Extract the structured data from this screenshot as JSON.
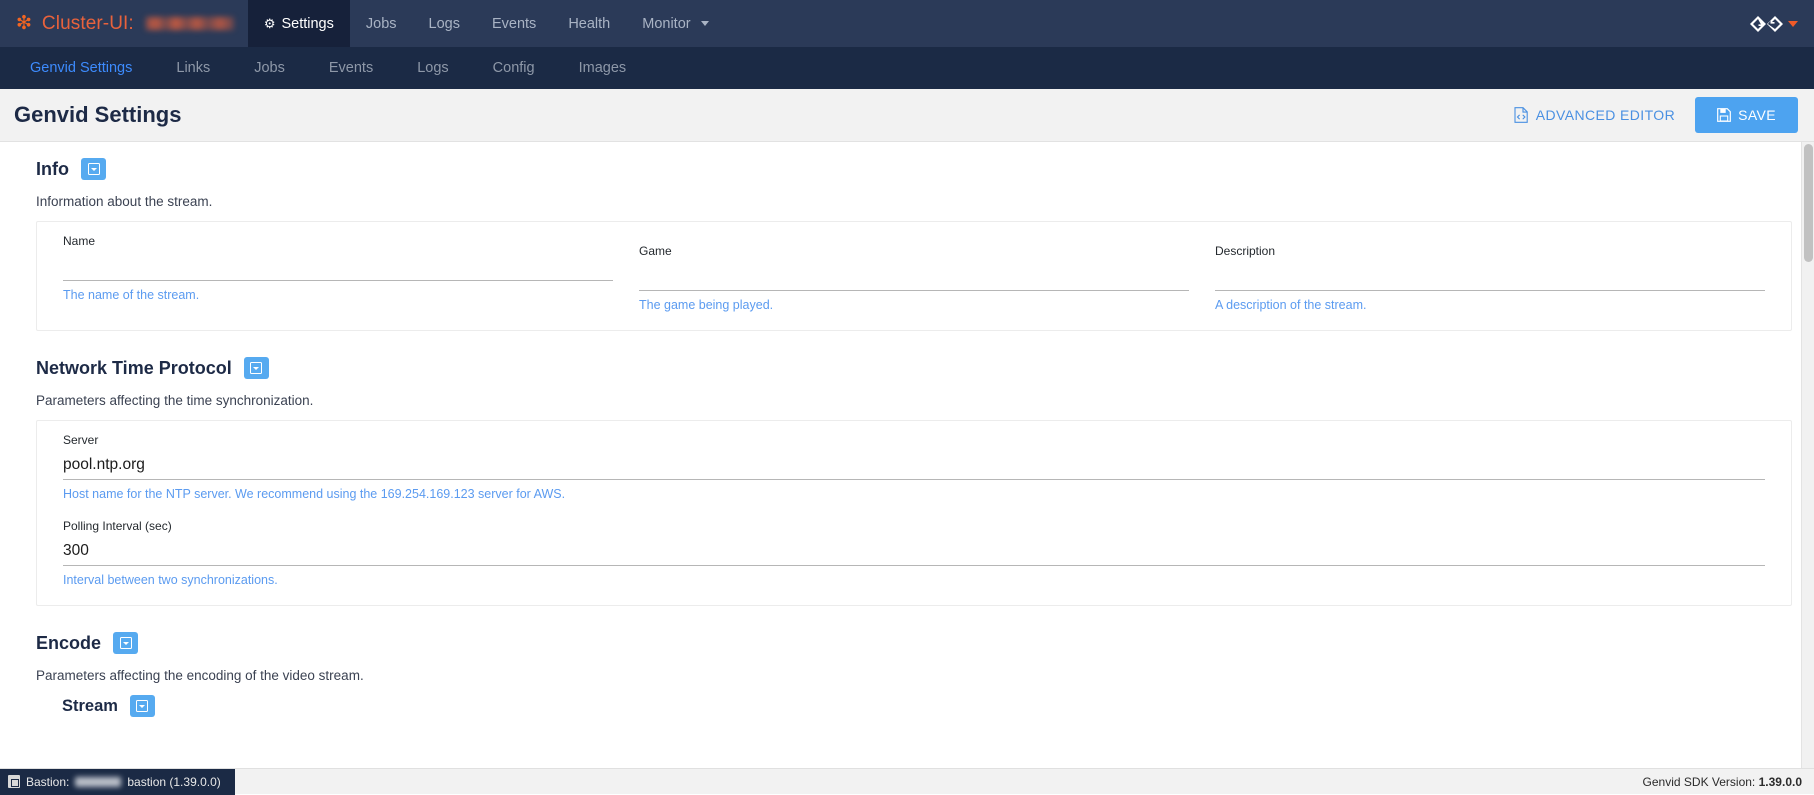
{
  "topnav": {
    "brand_prefix": "Cluster-UI:",
    "brand_logo_icon": "asterisk-icon",
    "cluster_name_redacted": "",
    "items": [
      {
        "label": "Settings",
        "icon": "gear-icon",
        "active": true
      },
      {
        "label": "Jobs",
        "active": false
      },
      {
        "label": "Logs",
        "active": false
      },
      {
        "label": "Events",
        "active": false
      },
      {
        "label": "Health",
        "active": false
      },
      {
        "label": "Monitor",
        "active": false,
        "has_caret": true
      }
    ],
    "right_logo_icon": "genvid-logo-icon",
    "right_caret_icon": "caret-down-icon"
  },
  "subnav": {
    "items": [
      {
        "label": "Genvid Settings",
        "active": true
      },
      {
        "label": "Links",
        "active": false
      },
      {
        "label": "Jobs",
        "active": false
      },
      {
        "label": "Events",
        "active": false
      },
      {
        "label": "Logs",
        "active": false
      },
      {
        "label": "Config",
        "active": false
      },
      {
        "label": "Images",
        "active": false
      }
    ]
  },
  "header": {
    "title": "Genvid Settings",
    "advanced_editor_label": "ADVANCED EDITOR",
    "advanced_editor_icon": "code-file-icon",
    "save_label": "SAVE",
    "save_icon": "floppy-disk-icon"
  },
  "sections": {
    "info": {
      "title": "Info",
      "description": "Information about the stream.",
      "fields": [
        {
          "label": "Name",
          "value": "",
          "hint": "The name of the stream."
        },
        {
          "label": "Game",
          "value": "",
          "hint": "The game being played."
        },
        {
          "label": "Description",
          "value": "",
          "hint": "A description of the stream."
        }
      ]
    },
    "ntp": {
      "title": "Network Time Protocol",
      "description": "Parameters affecting the time synchronization.",
      "fields": [
        {
          "label": "Server",
          "value": "pool.ntp.org",
          "hint": "Host name for the NTP server. We recommend using the 169.254.169.123 server for AWS."
        },
        {
          "label": "Polling Interval (sec)",
          "value": "300",
          "hint": "Interval between two synchronizations."
        }
      ]
    },
    "encode": {
      "title": "Encode",
      "description": "Parameters affecting the encoding of the video stream.",
      "stream": {
        "title": "Stream"
      }
    }
  },
  "footer": {
    "bastion_label": "Bastion:",
    "bastion_icon": "server-icon",
    "bastion_suffix": "bastion (1.39.0.0)",
    "sdk_label": "Genvid SDK Version:",
    "sdk_version": "1.39.0.0"
  },
  "colors": {
    "navbar_bg": "#2b3a58",
    "navbar_active_bg": "#16213a",
    "subnav_bg": "#1b2a45",
    "brand_orange": "#e8623c",
    "accent_blue": "#4da3f0",
    "hint_blue": "#5b9bf0",
    "title_navy": "#1d2a46"
  }
}
